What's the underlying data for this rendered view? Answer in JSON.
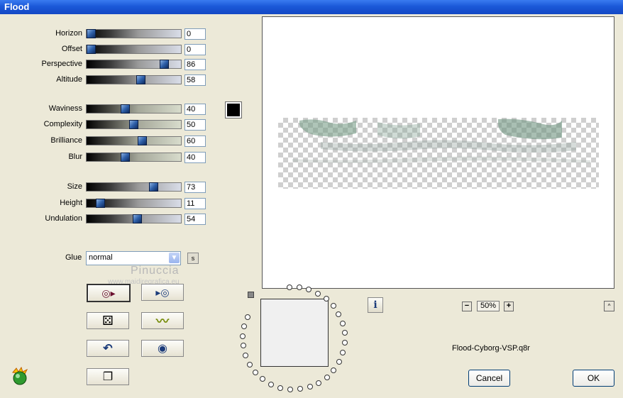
{
  "window": {
    "title": "Flood"
  },
  "sliders": [
    {
      "label": "Horizon",
      "value": "0",
      "level": 0
    },
    {
      "label": "Offset",
      "value": "0",
      "level": 0
    },
    {
      "label": "Perspective",
      "value": "86",
      "level": 86
    },
    {
      "label": "Altitude",
      "value": "58",
      "level": 58
    },
    {
      "label": "Waviness",
      "value": "40",
      "level": 40
    },
    {
      "label": "Complexity",
      "value": "50",
      "level": 50
    },
    {
      "label": "Brilliance",
      "value": "60",
      "level": 60
    },
    {
      "label": "Blur",
      "value": "40",
      "level": 40
    },
    {
      "label": "Size",
      "value": "73",
      "level": 73
    },
    {
      "label": "Height",
      "value": "11",
      "level": 11
    },
    {
      "label": "Undulation",
      "value": "54",
      "level": 54
    }
  ],
  "color": {
    "swatch": "#000000"
  },
  "glue": {
    "label": "Glue",
    "value": "normal",
    "s_button": "s"
  },
  "watermark": {
    "name": "Pinuccia",
    "url": "www.maidiregrafica.eu"
  },
  "tool_buttons": [
    {
      "name": "apply-preset-icon",
      "glyph": "◎▸"
    },
    {
      "name": "next-preset-icon",
      "glyph": "▸◎"
    },
    {
      "name": "random-dice-icon",
      "glyph": "⚄"
    },
    {
      "name": "wave-icon",
      "glyph": "〰"
    },
    {
      "name": "undo-icon",
      "glyph": "↶"
    },
    {
      "name": "reset-icon",
      "glyph": "◉"
    },
    {
      "name": "copy-icon",
      "glyph": "❐"
    }
  ],
  "preview": {
    "zoom": "50%",
    "zoom_minus": "−",
    "zoom_plus": "+",
    "up": "^",
    "info": "i"
  },
  "preset": {
    "filename": "Flood-Cyborg-VSP.q8r"
  },
  "buttons": {
    "cancel": "Cancel",
    "ok": "OK"
  }
}
